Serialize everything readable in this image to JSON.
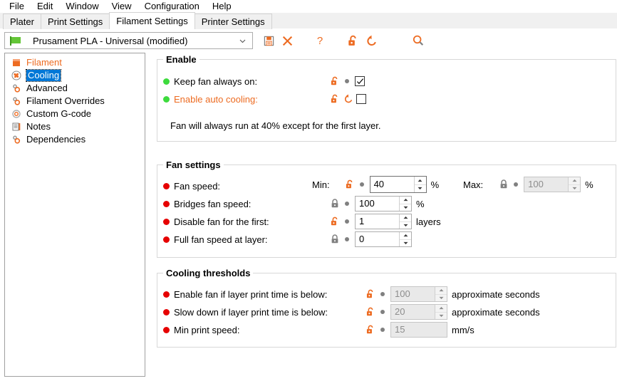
{
  "menubar": {
    "items": [
      {
        "label": "File"
      },
      {
        "label": "Edit"
      },
      {
        "label": "Window"
      },
      {
        "label": "View"
      },
      {
        "label": "Configuration"
      },
      {
        "label": "Help"
      }
    ]
  },
  "tabs": [
    {
      "label": "Plater",
      "active": false
    },
    {
      "label": "Print Settings",
      "active": false
    },
    {
      "label": "Filament Settings",
      "active": true
    },
    {
      "label": "Printer Settings",
      "active": false
    }
  ],
  "preset": {
    "value": "Prusament PLA - Universal (modified)",
    "flag_icon": "green-flag-icon",
    "dropdown_icon": "chevron-down-icon",
    "tools": [
      {
        "icon": "save-icon",
        "name": "save-preset-button"
      },
      {
        "icon": "delete-icon",
        "name": "delete-preset-button"
      },
      {
        "icon": "question-icon",
        "name": "help-button"
      },
      {
        "icon": "unlock-icon",
        "name": "lock-all-button"
      },
      {
        "icon": "revert-icon",
        "name": "revert-all-button"
      },
      {
        "icon": "search-icon",
        "name": "search-button"
      }
    ]
  },
  "sidebar": {
    "items": [
      {
        "label": "Filament",
        "icon": "filament-icon",
        "state": "modified"
      },
      {
        "label": "Cooling",
        "icon": "fan-icon",
        "state": "selected"
      },
      {
        "label": "Advanced",
        "icon": "gears-icon",
        "state": "normal"
      },
      {
        "label": "Filament Overrides",
        "icon": "gears-icon",
        "state": "normal"
      },
      {
        "label": "Custom G-code",
        "icon": "gear-outline-icon",
        "state": "normal"
      },
      {
        "label": "Notes",
        "icon": "notes-icon",
        "state": "normal"
      },
      {
        "label": "Dependencies",
        "icon": "gears-icon",
        "state": "normal"
      }
    ]
  },
  "colors": {
    "accent_orange": "#ed6b21",
    "selection_blue": "#0078d7",
    "bullet_green": "#3ddb3d",
    "bullet_red": "#e60000",
    "disabled_gray": "#8d8d8d"
  },
  "groups": {
    "enable": {
      "title": "Enable",
      "rows": [
        {
          "label": "Keep fan always on:",
          "bullet": "green",
          "label_modified": false,
          "lock": "unlock-orange-icon",
          "revert": "dot-placeholder",
          "control": "checkbox",
          "checked": true
        },
        {
          "label": "Enable auto cooling:",
          "bullet": "green",
          "label_modified": true,
          "lock": "unlock-orange-icon",
          "revert": "revert-orange-icon",
          "control": "checkbox",
          "checked": false
        }
      ],
      "note": "Fan will always run at 40% except for the first layer."
    },
    "fan_settings": {
      "title": "Fan settings",
      "min_label": "Min:",
      "max_label": "Max:",
      "rows": [
        {
          "label": "Fan speed:",
          "bullet": "red",
          "lock": "unlock-orange-icon",
          "revert": "dot-placeholder",
          "value": "40",
          "unit": "%",
          "disabled": false,
          "focused": true,
          "max": {
            "lock": "lock-gray-icon",
            "revert": "dot-placeholder",
            "value": "100",
            "unit": "%",
            "disabled": true
          }
        },
        {
          "label": "Bridges fan speed:",
          "bullet": "red",
          "lock": "lock-gray-icon",
          "revert": "dot-placeholder",
          "value": "100",
          "unit": "%",
          "disabled": false,
          "focused": false
        },
        {
          "label": "Disable fan for the first:",
          "bullet": "red",
          "lock": "unlock-orange-icon",
          "revert": "dot-placeholder",
          "value": "1",
          "unit": "layers",
          "disabled": false,
          "focused": false
        },
        {
          "label": "Full fan speed at layer:",
          "bullet": "red",
          "lock": "lock-gray-icon",
          "revert": "dot-placeholder",
          "value": "0",
          "unit": "",
          "disabled": false,
          "focused": false
        }
      ]
    },
    "cooling_thresholds": {
      "title": "Cooling thresholds",
      "rows": [
        {
          "label": "Enable fan if layer print time is below:",
          "bullet": "red",
          "lock": "unlock-orange-icon",
          "revert": "dot-placeholder",
          "value": "100",
          "unit": "approximate seconds",
          "disabled": true,
          "spinner": true
        },
        {
          "label": "Slow down if layer print time is below:",
          "bullet": "red",
          "lock": "unlock-orange-icon",
          "revert": "dot-placeholder",
          "value": "20",
          "unit": "approximate seconds",
          "disabled": true,
          "spinner": true
        },
        {
          "label": "Min print speed:",
          "bullet": "red",
          "lock": "unlock-orange-icon",
          "revert": "dot-placeholder",
          "value": "15",
          "unit": "mm/s",
          "disabled": true,
          "spinner": false
        }
      ]
    }
  }
}
